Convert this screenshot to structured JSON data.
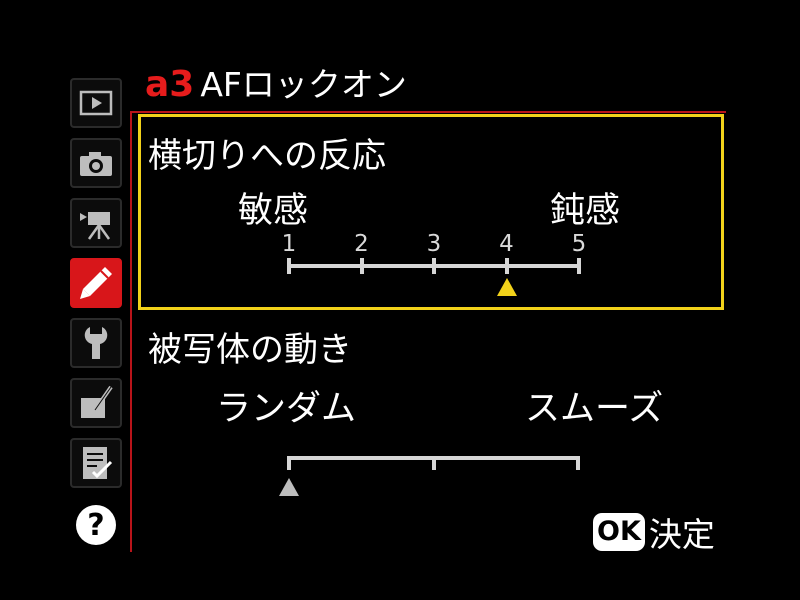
{
  "header": {
    "code": "a3",
    "title": "AFロックオン"
  },
  "sidebar": {
    "items": [
      {
        "name": "playback-menu",
        "icon": "play-icon",
        "active": false
      },
      {
        "name": "shooting-menu",
        "icon": "camera-icon",
        "active": false
      },
      {
        "name": "movie-menu",
        "icon": "movie-camera-icon",
        "active": false
      },
      {
        "name": "custom-settings-menu",
        "icon": "pencil-icon",
        "active": true
      },
      {
        "name": "setup-menu",
        "icon": "wrench-icon",
        "active": false
      },
      {
        "name": "retouch-menu",
        "icon": "retouch-brush-icon",
        "active": false
      },
      {
        "name": "my-menu",
        "icon": "checklist-icon",
        "active": false
      }
    ],
    "help_label": "?"
  },
  "section1": {
    "heading": "横切りへの反応",
    "left_label": "敏感",
    "right_label": "鈍感",
    "ticks": [
      "1",
      "2",
      "3",
      "4",
      "5"
    ],
    "selected_value": 4,
    "marker_color": "#f2d21a",
    "border_color": "#f2d21a"
  },
  "section2": {
    "heading": "被写体の動き",
    "left_label": "ランダム",
    "right_label": "スムーズ",
    "positions": 3,
    "selected_position": 1,
    "marker_color": "#bdbdbd"
  },
  "footer": {
    "ok_badge": "OK",
    "ok_label": "決定"
  },
  "colors": {
    "accent_red": "#d8161a",
    "highlight_yellow": "#f2d21a"
  }
}
